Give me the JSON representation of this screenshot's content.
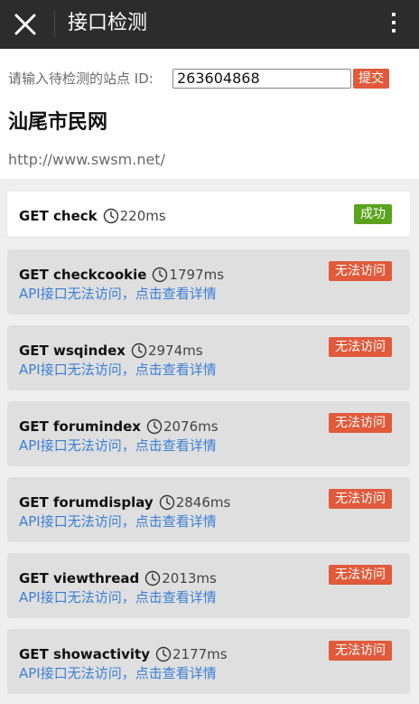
{
  "header": {
    "title": "接口检测"
  },
  "form": {
    "label": "请输入待检测的站点 ID:",
    "site_id": "263604868",
    "submit_label": "提交"
  },
  "site": {
    "name": "汕尾市民网",
    "url": "http://www.swsm.net/"
  },
  "colors": {
    "success": "#5aa31d",
    "fail": "#e05a3b",
    "link": "#3a7fd5",
    "topbar": "#2c2c2c"
  },
  "checks": [
    {
      "method": "GET check",
      "time": "220ms",
      "status": "成功"
    },
    {
      "method": "GET checkcookie",
      "time": "1797ms",
      "status": "无法访问",
      "detail": "API接口无法访问，点击查看详情"
    },
    {
      "method": "GET wsqindex",
      "time": "2974ms",
      "status": "无法访问",
      "detail": "API接口无法访问，点击查看详情"
    },
    {
      "method": "GET forumindex",
      "time": "2076ms",
      "status": "无法访问",
      "detail": "API接口无法访问，点击查看详情"
    },
    {
      "method": "GET forumdisplay",
      "time": "2846ms",
      "status": "无法访问",
      "detail": "API接口无法访问，点击查看详情"
    },
    {
      "method": "GET viewthread",
      "time": "2013ms",
      "status": "无法访问",
      "detail": "API接口无法访问，点击查看详情"
    },
    {
      "method": "GET showactivity",
      "time": "2177ms",
      "status": "无法访问",
      "detail": "API接口无法访问，点击查看详情"
    }
  ]
}
